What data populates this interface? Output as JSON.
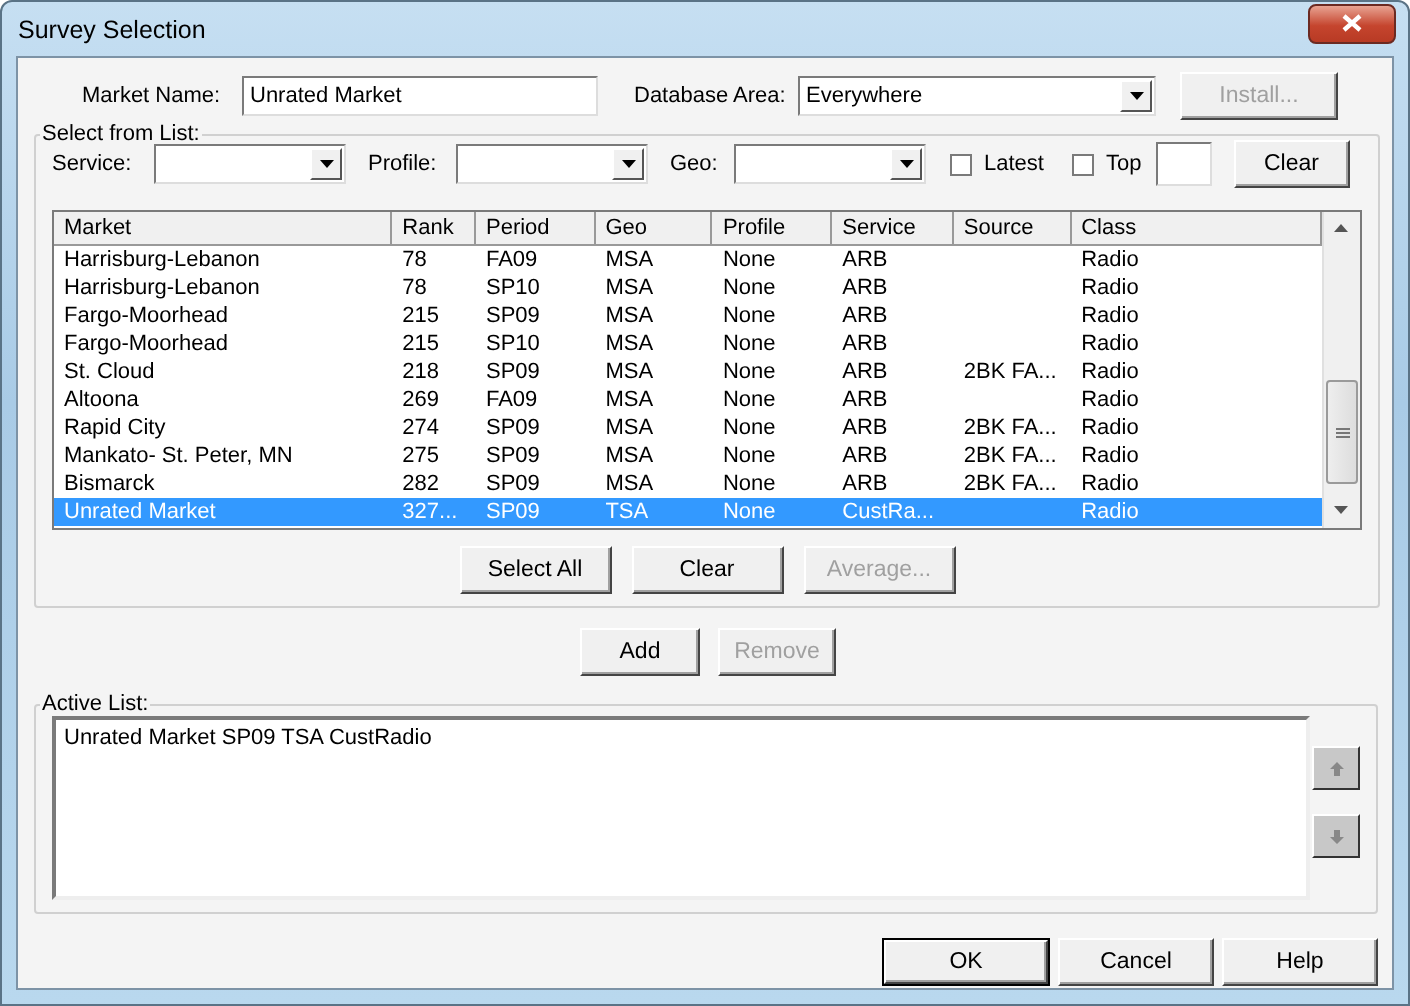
{
  "window": {
    "title": "Survey Selection"
  },
  "market_name": {
    "label": "Market Name:",
    "value": "Unrated Market"
  },
  "database_area": {
    "label": "Database Area:",
    "value": "Everywhere"
  },
  "install_button": {
    "label": "Install...",
    "disabled": true
  },
  "select_group": {
    "title": "Select from List:",
    "filters": [
      {
        "kind": "combo",
        "label": "Service:"
      },
      {
        "kind": "combo",
        "label": "Profile:"
      },
      {
        "kind": "combo",
        "label": "Geo:"
      },
      {
        "kind": "check",
        "label": "Latest",
        "checked": false
      },
      {
        "kind": "check",
        "label": "Top",
        "checked": false
      },
      {
        "kind": "input"
      },
      {
        "kind": "button",
        "label": "Clear",
        "disabled": false
      }
    ],
    "table": {
      "columns": [
        "Market",
        "Rank",
        "Period",
        "Geo",
        "Profile",
        "Service",
        "Source",
        "Class"
      ],
      "rows": [
        {
          "cells": [
            "Harrisburg-Lebanon",
            "78",
            "FA09",
            "MSA",
            "None",
            "ARB",
            "",
            "Radio"
          ],
          "selected": false
        },
        {
          "cells": [
            "Harrisburg-Lebanon",
            "78",
            "SP10",
            "MSA",
            "None",
            "ARB",
            "",
            "Radio"
          ],
          "selected": false
        },
        {
          "cells": [
            "Fargo-Moorhead",
            "215",
            "SP09",
            "MSA",
            "None",
            "ARB",
            "",
            "Radio"
          ],
          "selected": false
        },
        {
          "cells": [
            "Fargo-Moorhead",
            "215",
            "SP10",
            "MSA",
            "None",
            "ARB",
            "",
            "Radio"
          ],
          "selected": false
        },
        {
          "cells": [
            "St. Cloud",
            "218",
            "SP09",
            "MSA",
            "None",
            "ARB",
            "2BK FA...",
            "Radio"
          ],
          "selected": false
        },
        {
          "cells": [
            "Altoona",
            "269",
            "FA09",
            "MSA",
            "None",
            "ARB",
            "",
            "Radio"
          ],
          "selected": false
        },
        {
          "cells": [
            "Rapid City",
            "274",
            "SP09",
            "MSA",
            "None",
            "ARB",
            "2BK FA...",
            "Radio"
          ],
          "selected": false
        },
        {
          "cells": [
            "Mankato- St. Peter, MN",
            "275",
            "SP09",
            "MSA",
            "None",
            "ARB",
            "2BK FA...",
            "Radio"
          ],
          "selected": false
        },
        {
          "cells": [
            "Bismarck",
            "282",
            "SP09",
            "MSA",
            "None",
            "ARB",
            "2BK FA...",
            "Radio"
          ],
          "selected": false
        },
        {
          "cells": [
            "Unrated Market",
            "327...",
            "SP09",
            "TSA",
            "None",
            "CustRa...",
            "",
            "Radio"
          ],
          "selected": true
        }
      ]
    },
    "buttons": [
      {
        "label": "Select All",
        "disabled": false
      },
      {
        "label": "Clear",
        "disabled": false
      },
      {
        "label": "Average...",
        "disabled": true
      }
    ]
  },
  "list_buttons": [
    {
      "label": "Add",
      "disabled": false
    },
    {
      "label": "Remove",
      "disabled": true
    }
  ],
  "active_group": {
    "title": "Active List:",
    "items": [
      "Unrated Market SP09 TSA CustRadio"
    ]
  },
  "dialog_buttons": [
    {
      "label": "OK",
      "default": true
    },
    {
      "label": "Cancel",
      "default": false
    },
    {
      "label": "Help",
      "default": false
    }
  ]
}
